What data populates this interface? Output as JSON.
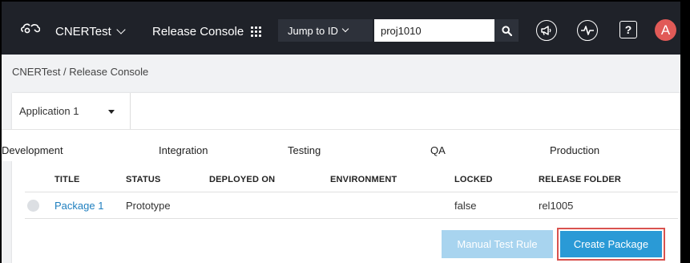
{
  "topbar": {
    "app_name": "CNERTest",
    "console_title": "Release Console",
    "jump_label": "Jump to ID",
    "search_value": "proj1010",
    "avatar_letter": "A",
    "help_glyph": "?"
  },
  "breadcrumb": "CNERTest / Release Console",
  "application_select": "Application 1",
  "stages": [
    "Development",
    "Integration",
    "Testing",
    "QA",
    "Production"
  ],
  "table": {
    "headers": [
      "TITLE",
      "STATUS",
      "DEPLOYED ON",
      "ENVIRONMENT",
      "LOCKED",
      "RELEASE FOLDER"
    ],
    "rows": [
      {
        "title": "Package 1",
        "status": "Prototype",
        "deployed_on": "",
        "environment": "",
        "locked": "false",
        "release_folder": "rel1005"
      }
    ]
  },
  "buttons": {
    "manual_test_rule": "Manual Test Rule",
    "create_package": "Create Package"
  },
  "colors": {
    "topbar": "#1f2229",
    "accent": "#2a9ad6",
    "link": "#1f7fbf",
    "avatar": "#e15a57",
    "highlight_outline": "#d9534f"
  }
}
